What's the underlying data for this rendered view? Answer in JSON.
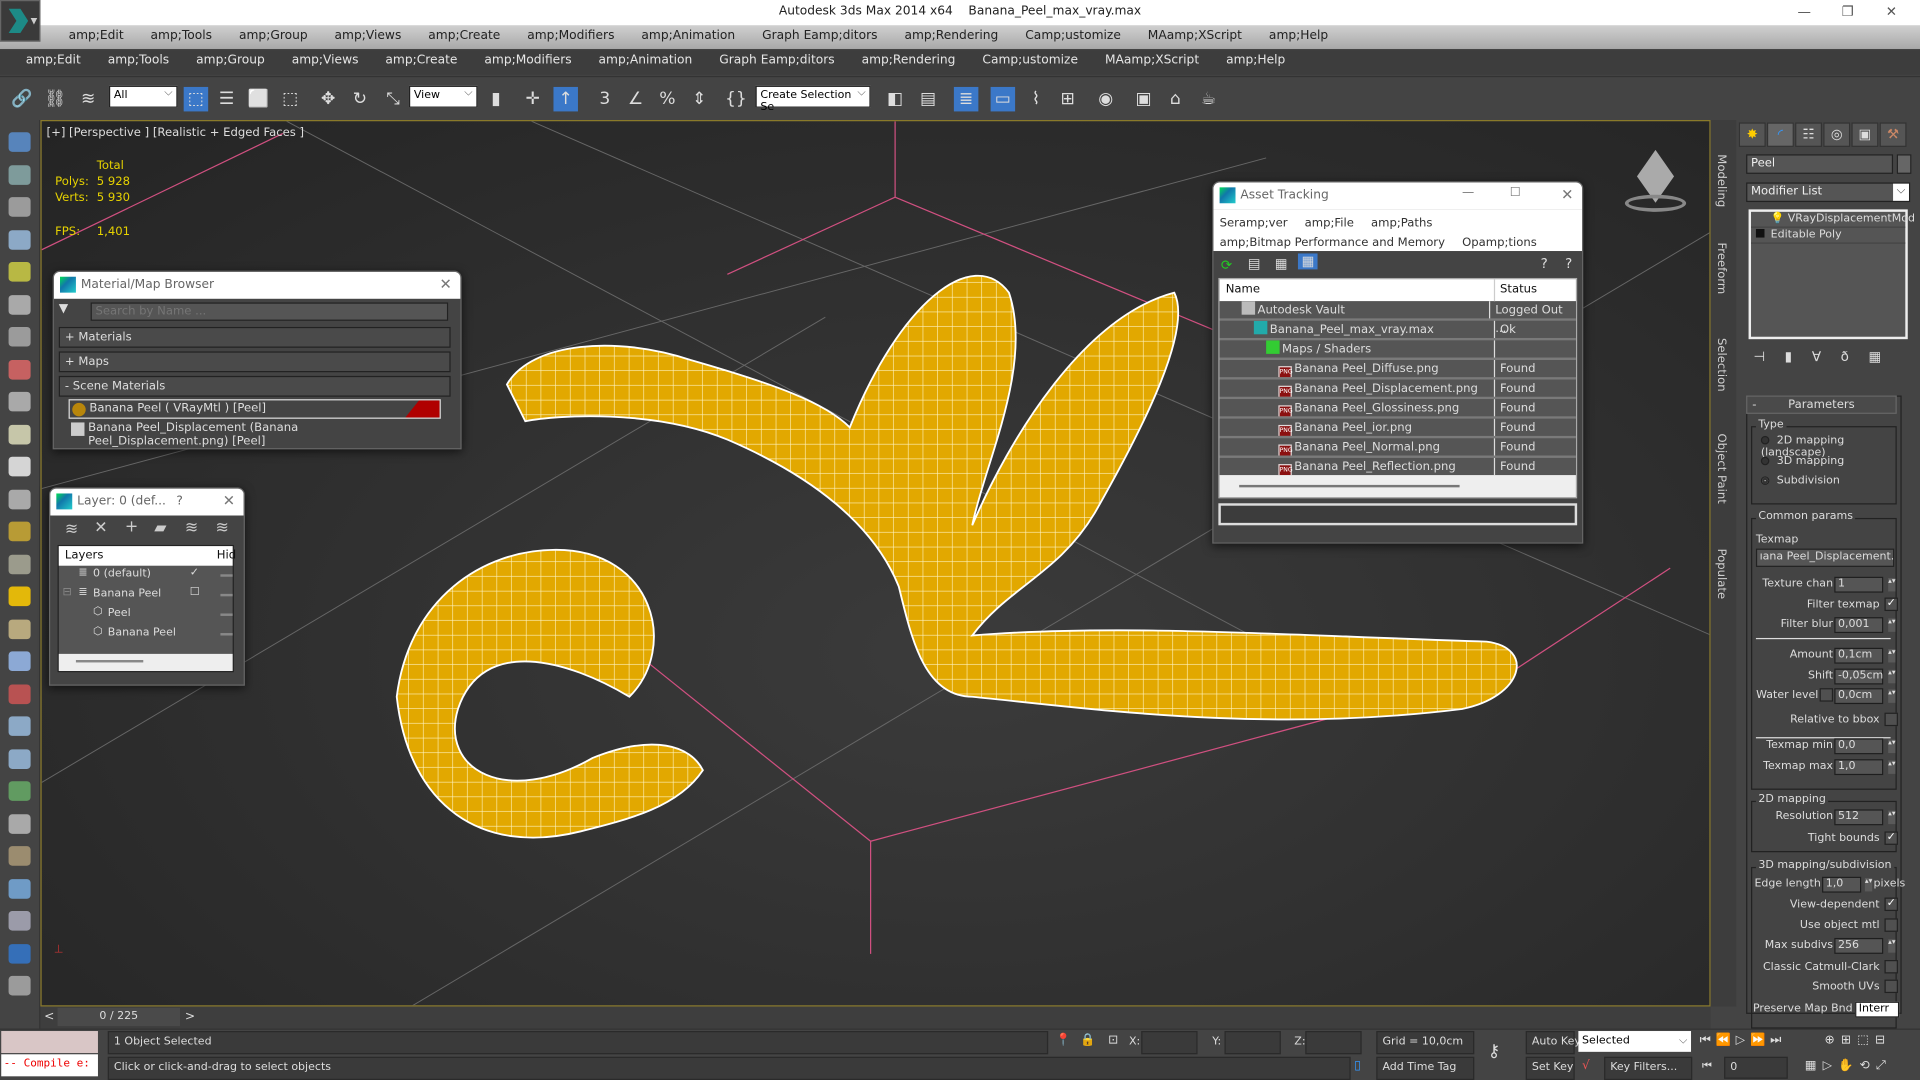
{
  "app": {
    "title": "Autodesk 3ds Max  2014 x64",
    "file": "Banana_Peel_max_vray.max"
  },
  "menu1": [
    "amp;Edit",
    "amp;Tools",
    "amp;Group",
    "amp;Views",
    "amp;Create",
    "amp;Modifiers",
    "amp;Animation",
    "Graph Eamp;ditors",
    "amp;Rendering",
    "Camp;ustomize",
    "MAamp;XScript",
    "amp;Help"
  ],
  "menu2": [
    "amp;Edit",
    "amp;Tools",
    "amp;Group",
    "amp;Views",
    "amp;Create",
    "amp;Modifiers",
    "amp;Animation",
    "Graph Eamp;ditors",
    "amp;Rendering",
    "Camp;ustomize",
    "MAamp;XScript",
    "amp;Help"
  ],
  "toolbar": {
    "selection_filter": "All",
    "ref_coord": "View",
    "named_selection": "Create Selection Se"
  },
  "viewport": {
    "label": "[+] [Perspective ] [Realistic + Edged Faces ]",
    "stats": {
      "total_label": "Total",
      "polys_label": "Polys:",
      "polys": "5 928",
      "verts_label": "Verts:",
      "verts": "5 930",
      "fps_label": "FPS:",
      "fps": "1,401"
    }
  },
  "material_browser": {
    "title": "Material/Map Browser",
    "search_placeholder": "Search by Name ...",
    "sections": [
      "+ Materials",
      "+ Maps",
      "-  Scene Materials"
    ],
    "items": [
      "Banana Peel  ( VRayMtl ) [Peel]",
      "Banana Peel_Displacement (Banana Peel_Displacement.png)  [Peel]"
    ],
    "accent": "#b00000"
  },
  "layer_dialog": {
    "title": "Layer: 0 (def...",
    "help": "?",
    "col_layers": "Layers",
    "col_hide": "Hid",
    "rows": [
      {
        "name": "0 (default)",
        "mark": "✓"
      },
      {
        "name": "Banana Peel",
        "mark": "☐"
      },
      {
        "name": "Peel",
        "mark": ""
      },
      {
        "name": "Banana Peel",
        "mark": ""
      }
    ]
  },
  "asset_tracking": {
    "title": "Asset Tracking",
    "menu": [
      "Seramp;ver",
      "amp;File",
      "amp;Paths"
    ],
    "menu2": [
      "amp;Bitmap Performance and Memory",
      "Opamp;tions"
    ],
    "col_name": "Name",
    "col_status": "Status",
    "rows": [
      {
        "name": "Autodesk Vault",
        "status": "Logged Out ...",
        "icon": "vault-icon",
        "indent": 2
      },
      {
        "name": "Banana_Peel_max_vray.max",
        "status": "Ok",
        "icon": "max-file-icon",
        "indent": 3
      },
      {
        "name": "Maps / Shaders",
        "status": "",
        "icon": "maps-icon",
        "indent": 4
      },
      {
        "name": "Banana Peel_Diffuse.png",
        "status": "Found",
        "icon": "png-icon",
        "indent": 5
      },
      {
        "name": "Banana Peel_Displacement.png",
        "status": "Found",
        "icon": "png-icon",
        "indent": 5
      },
      {
        "name": "Banana Peel_Glossiness.png",
        "status": "Found",
        "icon": "png-icon",
        "indent": 5
      },
      {
        "name": "Banana Peel_ior.png",
        "status": "Found",
        "icon": "png-icon",
        "indent": 5
      },
      {
        "name": "Banana Peel_Normal.png",
        "status": "Found",
        "icon": "png-icon",
        "indent": 5
      },
      {
        "name": "Banana Peel_Reflection.png",
        "status": "Found",
        "icon": "png-icon",
        "indent": 5
      }
    ]
  },
  "side_tabs": [
    "Modeling",
    "Freeform",
    "Selection",
    "Object Paint",
    "Populate"
  ],
  "command_panel": {
    "object_name": "Peel",
    "modifier_list": "Modifier List",
    "stack": [
      "VRayDisplacementMod",
      "Editable Poly"
    ],
    "rollout": "Parameters",
    "type_label": "Type",
    "types": [
      {
        "label": "2D mapping (landscape)",
        "on": false
      },
      {
        "label": "3D mapping",
        "on": false
      },
      {
        "label": "Subdivision",
        "on": true
      }
    ],
    "common_label": "Common params",
    "texmap_label": "Texmap",
    "texmap": "ıana Peel_Displacement.png)",
    "texture_chan": {
      "label": "Texture chan",
      "value": "1"
    },
    "filter_texmap": {
      "label": "Filter texmap",
      "checked": true
    },
    "filter_blur": {
      "label": "Filter blur",
      "value": "0,001"
    },
    "amount": {
      "label": "Amount",
      "value": "0,1cm"
    },
    "shift": {
      "label": "Shift",
      "value": "-0,05cm"
    },
    "water_level": {
      "label": "Water level",
      "value": "0,0cm",
      "checked": false
    },
    "relative_bbox": {
      "label": "Relative to bbox",
      "checked": false
    },
    "texmap_min": {
      "label": "Texmap min",
      "value": "0,0"
    },
    "texmap_max": {
      "label": "Texmap max",
      "value": "1,0"
    },
    "mapping2d_label": "2D mapping",
    "resolution": {
      "label": "Resolution",
      "value": "512"
    },
    "tight_bounds": {
      "label": "Tight bounds",
      "checked": true
    },
    "mapping3d_label": "3D mapping/subdivision",
    "edge_length": {
      "label": "Edge length",
      "value": "1,0",
      "unit": "pixels"
    },
    "view_dependent": {
      "label": "View-dependent",
      "checked": true
    },
    "use_object_mtl": {
      "label": "Use object mtl",
      "checked": false
    },
    "max_subdivs": {
      "label": "Max subdivs",
      "value": "256"
    },
    "catmull": {
      "label": "Classic Catmull-Clark",
      "checked": false
    },
    "smooth_uvs": {
      "label": "Smooth UVs",
      "checked": false
    },
    "preserve": {
      "label": "Preserve Map Bnd",
      "value": "Interr"
    }
  },
  "timeline": {
    "frame": "0 / 225",
    "prev": "<",
    "next": ">"
  },
  "status": {
    "script": "-- Compile e:",
    "selected": "1 Object Selected",
    "prompt": "Click or click-and-drag to select objects",
    "x_label": "X:",
    "y_label": "Y:",
    "z_label": "Z:",
    "grid": "Grid = 10,0cm",
    "add_time_tag": "Add Time Tag",
    "auto_key": "Auto Key",
    "set_key": "Set Key",
    "key_mode": "Selected",
    "key_filters": "Key Filters...",
    "frame": "0"
  }
}
